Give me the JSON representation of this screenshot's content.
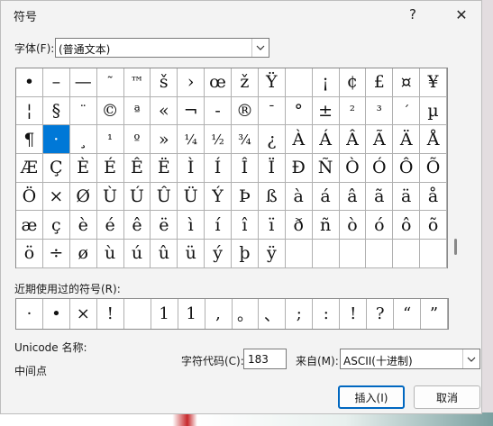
{
  "dialog": {
    "title": "符号",
    "help": "?",
    "close": "✕"
  },
  "font": {
    "label": "字体(F):",
    "value": "(普通文本)"
  },
  "symbols": [
    [
      "•",
      "–",
      "—",
      "˜",
      "™",
      "š",
      "›",
      "œ",
      "ž",
      "Ÿ",
      "",
      "¡",
      "¢",
      "£",
      "¤",
      "¥"
    ],
    [
      "¦",
      "§",
      "¨",
      "©",
      "ª",
      "«",
      "¬",
      "-",
      "®",
      "¯",
      "°",
      "±",
      "²",
      "³",
      "´",
      "µ"
    ],
    [
      "¶",
      "·",
      "¸",
      "¹",
      "º",
      "»",
      "¼",
      "½",
      "¾",
      "¿",
      "À",
      "Á",
      "Â",
      "Ã",
      "Ä",
      "Å"
    ],
    [
      "Æ",
      "Ç",
      "È",
      "É",
      "Ê",
      "Ë",
      "Ì",
      "Í",
      "Î",
      "Ï",
      "Ð",
      "Ñ",
      "Ò",
      "Ó",
      "Ô",
      "Õ"
    ],
    [
      "Ö",
      "×",
      "Ø",
      "Ù",
      "Ú",
      "Û",
      "Ü",
      "Ý",
      "Þ",
      "ß",
      "à",
      "á",
      "â",
      "ã",
      "ä",
      "å"
    ],
    [
      "æ",
      "ç",
      "è",
      "é",
      "ê",
      "ë",
      "ì",
      "í",
      "î",
      "ï",
      "ð",
      "ñ",
      "ò",
      "ó",
      "ô",
      "õ"
    ],
    [
      "ö",
      "÷",
      "ø",
      "ù",
      "ú",
      "û",
      "ü",
      "ý",
      "þ",
      "ÿ",
      "",
      "",
      "",
      "",
      "",
      ""
    ]
  ],
  "selected_symbol": "·",
  "recent": {
    "label": "近期使用过的符号(R):",
    "items": [
      "·",
      "•",
      "×",
      "!",
      "",
      "1",
      "1",
      ",",
      "。",
      "、",
      ";",
      ":",
      "!",
      "?",
      "“",
      "”"
    ]
  },
  "unicode_label": "Unicode 名称:",
  "char_name": "中间点",
  "code": {
    "label": "字符代码(C):",
    "value": "183"
  },
  "from": {
    "label": "来自(M):",
    "value": "ASCII(十进制)"
  },
  "buttons": {
    "insert": "插入(I)",
    "cancel": "取消"
  }
}
